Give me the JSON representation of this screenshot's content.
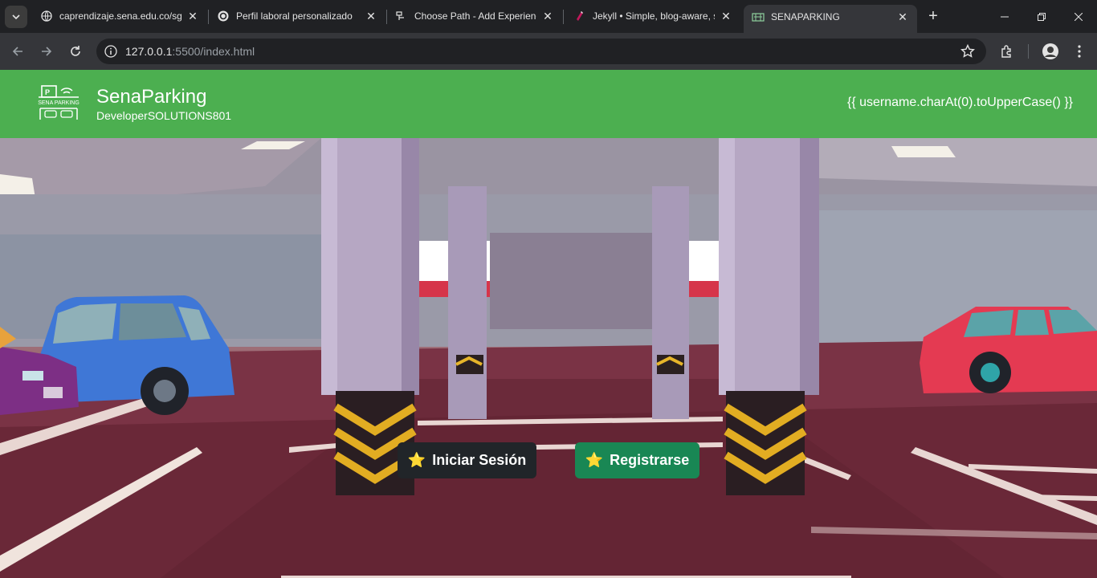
{
  "browser": {
    "tabs": [
      {
        "title": "caprendizaje.sena.edu.co/sg",
        "icon": "globe-icon"
      },
      {
        "title": "Perfil laboral personalizado",
        "icon": "openai-icon"
      },
      {
        "title": "Choose Path - Add Experienc",
        "icon": "path-icon"
      },
      {
        "title": "Jekyll • Simple, blog-aware, s",
        "icon": "jekyll-icon"
      },
      {
        "title": "SENAPARKING",
        "icon": "parking-logo-icon"
      }
    ],
    "url_host": "127.0.0.1",
    "url_path": ":5500/index.html"
  },
  "header": {
    "title": "SenaParking",
    "subtitle": "DeveloperSOLUTIONS801",
    "logo_text": "SENA PARKING",
    "user_initial": "{{ username.charAt(0).toUpperCase() }}"
  },
  "actions": {
    "login_label": "Iniciar Sesión",
    "register_label": "Registrarse",
    "star_glyph": "⭐"
  },
  "colors": {
    "header_green": "#4caf50",
    "login_bg": "#212529",
    "register_bg": "#198754"
  }
}
